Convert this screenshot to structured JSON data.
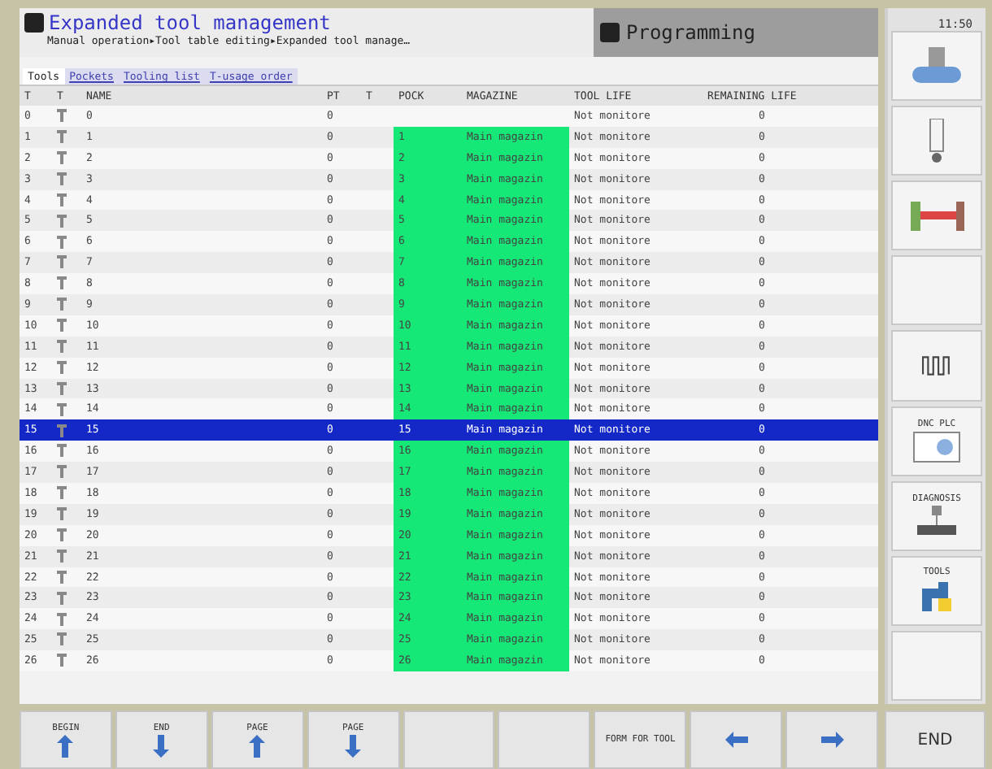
{
  "header": {
    "title": "Expanded tool management",
    "path": "Manual operation▸Tool table editing▸Expanded tool manage…",
    "mode": "Programming",
    "clock": "11:50"
  },
  "tabs": [
    {
      "label": "Tools",
      "selected": true
    },
    {
      "label": "Pockets",
      "selected": false
    },
    {
      "label": "Tooling list",
      "selected": false
    },
    {
      "label": "T-usage order",
      "selected": false
    }
  ],
  "columns": [
    "T",
    "T",
    "NAME",
    "PT",
    "T",
    "POCK",
    "MAGAZINE",
    "TOOL LIFE",
    "REMAINING LIFE"
  ],
  "rows": [
    {
      "t": "0",
      "name": "0",
      "pt": "0",
      "tool_life": "Not monitore",
      "remaining": "0",
      "selected": false
    },
    {
      "t": "1",
      "name": "1",
      "pt": "0",
      "pocket": "1",
      "magazine": "Main magazin",
      "tool_life": "Not monitore",
      "remaining": "0",
      "selected": false
    },
    {
      "t": "2",
      "name": "2",
      "pt": "0",
      "pocket": "2",
      "magazine": "Main magazin",
      "tool_life": "Not monitore",
      "remaining": "0",
      "selected": false
    },
    {
      "t": "3",
      "name": "3",
      "pt": "0",
      "pocket": "3",
      "magazine": "Main magazin",
      "tool_life": "Not monitore",
      "remaining": "0",
      "selected": false
    },
    {
      "t": "4",
      "name": "4",
      "pt": "0",
      "pocket": "4",
      "magazine": "Main magazin",
      "tool_life": "Not monitore",
      "remaining": "0",
      "selected": false
    },
    {
      "t": "5",
      "name": "5",
      "pt": "0",
      "pocket": "5",
      "magazine": "Main magazin",
      "tool_life": "Not monitore",
      "remaining": "0",
      "selected": false
    },
    {
      "t": "6",
      "name": "6",
      "pt": "0",
      "pocket": "6",
      "magazine": "Main magazin",
      "tool_life": "Not monitore",
      "remaining": "0",
      "selected": false
    },
    {
      "t": "7",
      "name": "7",
      "pt": "0",
      "pocket": "7",
      "magazine": "Main magazin",
      "tool_life": "Not monitore",
      "remaining": "0",
      "selected": false
    },
    {
      "t": "8",
      "name": "8",
      "pt": "0",
      "pocket": "8",
      "magazine": "Main magazin",
      "tool_life": "Not monitore",
      "remaining": "0",
      "selected": false
    },
    {
      "t": "9",
      "name": "9",
      "pt": "0",
      "pocket": "9",
      "magazine": "Main magazin",
      "tool_life": "Not monitore",
      "remaining": "0",
      "selected": false
    },
    {
      "t": "10",
      "name": "10",
      "pt": "0",
      "pocket": "10",
      "magazine": "Main magazin",
      "tool_life": "Not monitore",
      "remaining": "0",
      "selected": false
    },
    {
      "t": "11",
      "name": "11",
      "pt": "0",
      "pocket": "11",
      "magazine": "Main magazin",
      "tool_life": "Not monitore",
      "remaining": "0",
      "selected": false
    },
    {
      "t": "12",
      "name": "12",
      "pt": "0",
      "pocket": "12",
      "magazine": "Main magazin",
      "tool_life": "Not monitore",
      "remaining": "0",
      "selected": false
    },
    {
      "t": "13",
      "name": "13",
      "pt": "0",
      "pocket": "13",
      "magazine": "Main magazin",
      "tool_life": "Not monitore",
      "remaining": "0",
      "selected": false
    },
    {
      "t": "14",
      "name": "14",
      "pt": "0",
      "pocket": "14",
      "magazine": "Main magazin",
      "tool_life": "Not monitore",
      "remaining": "0",
      "selected": false
    },
    {
      "t": "15",
      "name": "15",
      "pt": "0",
      "pocket": "15",
      "magazine": "Main magazin",
      "tool_life": "Not monitore",
      "remaining": "0",
      "selected": true
    },
    {
      "t": "16",
      "name": "16",
      "pt": "0",
      "pocket": "16",
      "magazine": "Main magazin",
      "tool_life": "Not monitore",
      "remaining": "0",
      "selected": false
    },
    {
      "t": "17",
      "name": "17",
      "pt": "0",
      "pocket": "17",
      "magazine": "Main magazin",
      "tool_life": "Not monitore",
      "remaining": "0",
      "selected": false
    },
    {
      "t": "18",
      "name": "18",
      "pt": "0",
      "pocket": "18",
      "magazine": "Main magazin",
      "tool_life": "Not monitore",
      "remaining": "0",
      "selected": false
    },
    {
      "t": "19",
      "name": "19",
      "pt": "0",
      "pocket": "19",
      "magazine": "Main magazin",
      "tool_life": "Not monitore",
      "remaining": "0",
      "selected": false
    },
    {
      "t": "20",
      "name": "20",
      "pt": "0",
      "pocket": "20",
      "magazine": "Main magazin",
      "tool_life": "Not monitore",
      "remaining": "0",
      "selected": false
    },
    {
      "t": "21",
      "name": "21",
      "pt": "0",
      "pocket": "21",
      "magazine": "Main magazin",
      "tool_life": "Not monitore",
      "remaining": "0",
      "selected": false
    },
    {
      "t": "22",
      "name": "22",
      "pt": "0",
      "pocket": "22",
      "magazine": "Main magazin",
      "tool_life": "Not monitore",
      "remaining": "0",
      "selected": false
    },
    {
      "t": "23",
      "name": "23",
      "pt": "0",
      "pocket": "23",
      "magazine": "Main magazin",
      "tool_life": "Not monitore",
      "remaining": "0",
      "selected": false
    },
    {
      "t": "24",
      "name": "24",
      "pt": "0",
      "pocket": "24",
      "magazine": "Main magazin",
      "tool_life": "Not monitore",
      "remaining": "0",
      "selected": false
    },
    {
      "t": "25",
      "name": "25",
      "pt": "0",
      "pocket": "25",
      "magazine": "Main magazin",
      "tool_life": "Not monitore",
      "remaining": "0",
      "selected": false
    },
    {
      "t": "26",
      "name": "26",
      "pt": "0",
      "pocket": "26",
      "magazine": "Main magazin",
      "tool_life": "Not monitore",
      "remaining": "0",
      "selected": false
    }
  ],
  "side_keys": [
    {
      "kind": "spindle"
    },
    {
      "kind": "tool"
    },
    {
      "kind": "holder"
    },
    {
      "kind": "blank"
    },
    {
      "kind": "feed"
    },
    {
      "kind": "plc",
      "label": "DNC PLC"
    },
    {
      "kind": "diagnosis",
      "label": "DIAGNOSIS"
    },
    {
      "kind": "python",
      "label": "TOOLS"
    },
    {
      "kind": "blank"
    }
  ],
  "softkeys": [
    {
      "kind": "up",
      "label": "BEGIN"
    },
    {
      "kind": "down",
      "label": "END"
    },
    {
      "kind": "up",
      "label": "PAGE"
    },
    {
      "kind": "down",
      "label": "PAGE"
    },
    {
      "kind": "blank"
    },
    {
      "kind": "blank"
    },
    {
      "kind": "text",
      "label": "FORM FOR TOOL"
    },
    {
      "kind": "left"
    },
    {
      "kind": "right"
    },
    {
      "kind": "text",
      "label": "END"
    }
  ]
}
